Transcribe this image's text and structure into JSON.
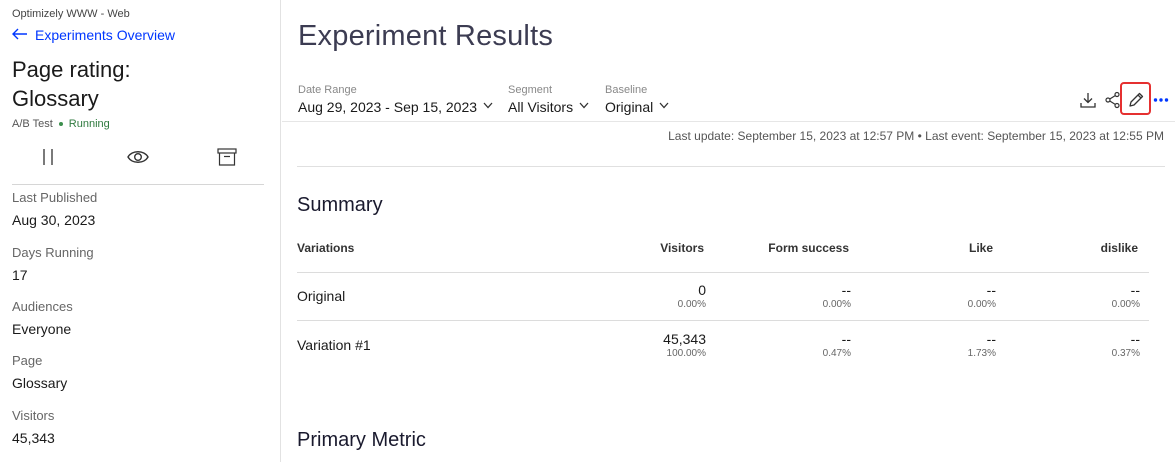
{
  "sidebar": {
    "org": "Optimizely WWW - Web",
    "back_link": "Experiments Overview",
    "title_line1": "Page rating:",
    "title_line2": "Glossary",
    "type": "A/B Test",
    "status": "Running",
    "info": [
      {
        "label": "Last Published",
        "value": "Aug 30, 2023"
      },
      {
        "label": "Days Running",
        "value": "17"
      },
      {
        "label": "Audiences",
        "value": "Everyone"
      },
      {
        "label": "Page",
        "value": "Glossary"
      },
      {
        "label": "Visitors",
        "value": "45,343"
      }
    ]
  },
  "main": {
    "title": "Experiment Results",
    "filters": {
      "date_range": {
        "label": "Date Range",
        "value": "Aug 29, 2023 - Sep 15, 2023"
      },
      "segment": {
        "label": "Segment",
        "value": "All Visitors"
      },
      "baseline": {
        "label": "Baseline",
        "value": "Original"
      }
    },
    "last_update": "Last update: September 15, 2023 at 12:57 PM • Last event: September 15, 2023 at 12:55 PM",
    "summary": {
      "title": "Summary",
      "columns": [
        "Variations",
        "Visitors",
        "Form success",
        "Like",
        "dislike"
      ],
      "rows": [
        {
          "name": "Original",
          "visitors": "0",
          "visitors_pct": "0.00%",
          "form": "--",
          "form_pct": "0.00%",
          "like": "--",
          "like_pct": "0.00%",
          "dislike": "--",
          "dislike_pct": "0.00%"
        },
        {
          "name": "Variation #1",
          "visitors": "45,343",
          "visitors_pct": "100.00%",
          "form": "--",
          "form_pct": "0.47%",
          "like": "--",
          "like_pct": "1.73%",
          "dislike": "--",
          "dislike_pct": "0.37%"
        }
      ]
    },
    "primary_metric_title": "Primary Metric"
  },
  "colors": {
    "link": "#0037ff",
    "status": "#2f7a3f",
    "highlight": "#e53030"
  }
}
